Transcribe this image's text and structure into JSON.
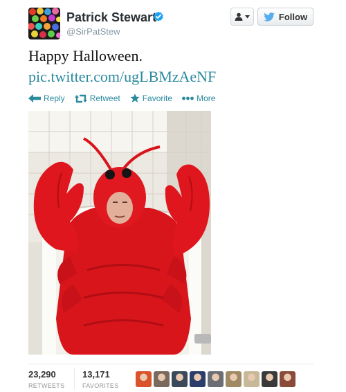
{
  "user": {
    "name": "Patrick Stewart",
    "handle": "@SirPatStew"
  },
  "header": {
    "follow_label": "Follow"
  },
  "tweet": {
    "text": "Happy Halloween.",
    "link": "pic.twitter.com/ugLBMzAeNF"
  },
  "actions": {
    "reply": "Reply",
    "retweet": "Retweet",
    "favorite": "Favorite",
    "more": "More"
  },
  "stats": {
    "retweets_count": "23,290",
    "retweets_label": "RETWEETS",
    "favorites_count": "13,171",
    "favorites_label": "FAVORITES"
  },
  "favoriter_avatar_colors": [
    "#d9542a",
    "#7a6a5e",
    "#3b4a5a",
    "#2a3d6b",
    "#6b6f75",
    "#a08a63",
    "#c7b89a",
    "#3a3a3a",
    "#8a4b3a"
  ],
  "colors": {
    "link": "#2a8a9e",
    "verified": "#1da1f2",
    "twitter_bird": "#55acee"
  }
}
